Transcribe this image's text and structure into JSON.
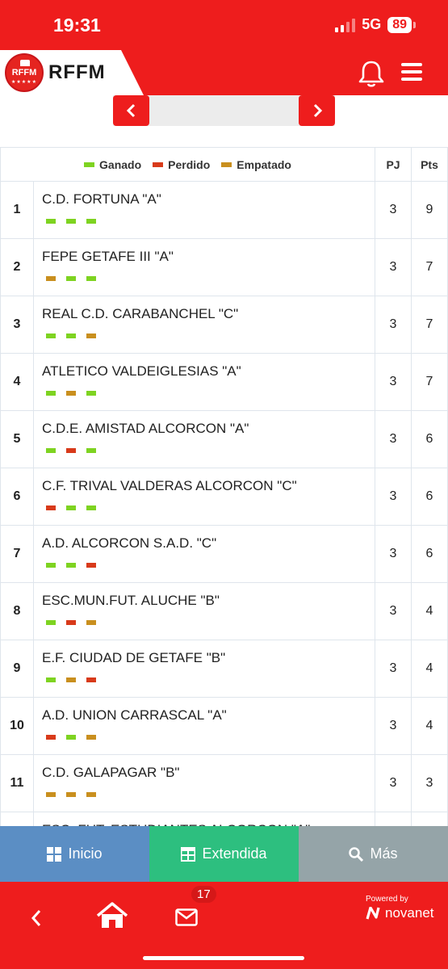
{
  "status_bar": {
    "time": "19:31",
    "network": "5G",
    "battery": "89"
  },
  "header": {
    "logo_text": "RFFM",
    "badge_text": "RFFM"
  },
  "legend": {
    "won": "Ganado",
    "lost": "Perdido",
    "drawn": "Empatado"
  },
  "table": {
    "col_pj": "PJ",
    "col_pts": "Pts",
    "rows": [
      {
        "pos": "1",
        "team": "C.D. FORTUNA \"A\"",
        "pj": "3",
        "pts": "9",
        "form": [
          "W",
          "W",
          "W"
        ]
      },
      {
        "pos": "2",
        "team": "FEPE GETAFE III \"A\"",
        "pj": "3",
        "pts": "7",
        "form": [
          "D",
          "W",
          "W"
        ]
      },
      {
        "pos": "3",
        "team": "REAL C.D. CARABANCHEL \"C\"",
        "pj": "3",
        "pts": "7",
        "form": [
          "W",
          "W",
          "D"
        ]
      },
      {
        "pos": "4",
        "team": "ATLETICO VALDEIGLESIAS \"A\"",
        "pj": "3",
        "pts": "7",
        "form": [
          "W",
          "D",
          "W"
        ]
      },
      {
        "pos": "5",
        "team": "C.D.E. AMISTAD ALCORCON \"A\"",
        "pj": "3",
        "pts": "6",
        "form": [
          "W",
          "L",
          "W"
        ]
      },
      {
        "pos": "6",
        "team": "C.F. TRIVAL VALDERAS ALCORCON \"C\"",
        "pj": "3",
        "pts": "6",
        "form": [
          "L",
          "W",
          "W"
        ]
      },
      {
        "pos": "7",
        "team": "A.D. ALCORCON S.A.D. \"C\"",
        "pj": "3",
        "pts": "6",
        "form": [
          "W",
          "W",
          "L"
        ]
      },
      {
        "pos": "8",
        "team": "ESC.MUN.FUT. ALUCHE \"B\"",
        "pj": "3",
        "pts": "4",
        "form": [
          "W",
          "L",
          "D"
        ]
      },
      {
        "pos": "9",
        "team": "E.F. CIUDAD DE GETAFE \"B\"",
        "pj": "3",
        "pts": "4",
        "form": [
          "W",
          "D",
          "L"
        ]
      },
      {
        "pos": "10",
        "team": "A.D. UNION CARRASCAL \"A\"",
        "pj": "3",
        "pts": "4",
        "form": [
          "L",
          "W",
          "D"
        ]
      },
      {
        "pos": "11",
        "team": "C.D. GALAPAGAR \"B\"",
        "pj": "3",
        "pts": "3",
        "form": [
          "D",
          "D",
          "D"
        ]
      },
      {
        "pos": "",
        "team": "ESC. FUT. ESTUDIANTES ALCORCON \"A\"",
        "pj": "",
        "pts": "",
        "form": []
      }
    ]
  },
  "bottom_tabs": {
    "inicio": "Inicio",
    "extendida": "Extendida",
    "mas": "Más"
  },
  "footer": {
    "badge_count": "17",
    "powered_by": "Powered by",
    "brand": "novanet"
  },
  "colors": {
    "brand_red": "#ee1d1d",
    "won": "#7ed321",
    "lost": "#d83a1a",
    "drawn": "#c98f1e",
    "inicio": "#5b8ec4",
    "extendida": "#2dbf7f",
    "mas": "#95a4a8"
  },
  "icons": [
    "bell-icon",
    "menu-icon",
    "chevron-left-icon",
    "chevron-right-icon",
    "grid-icon",
    "table-icon",
    "search-icon",
    "back-icon",
    "home-icon",
    "mail-icon"
  ]
}
